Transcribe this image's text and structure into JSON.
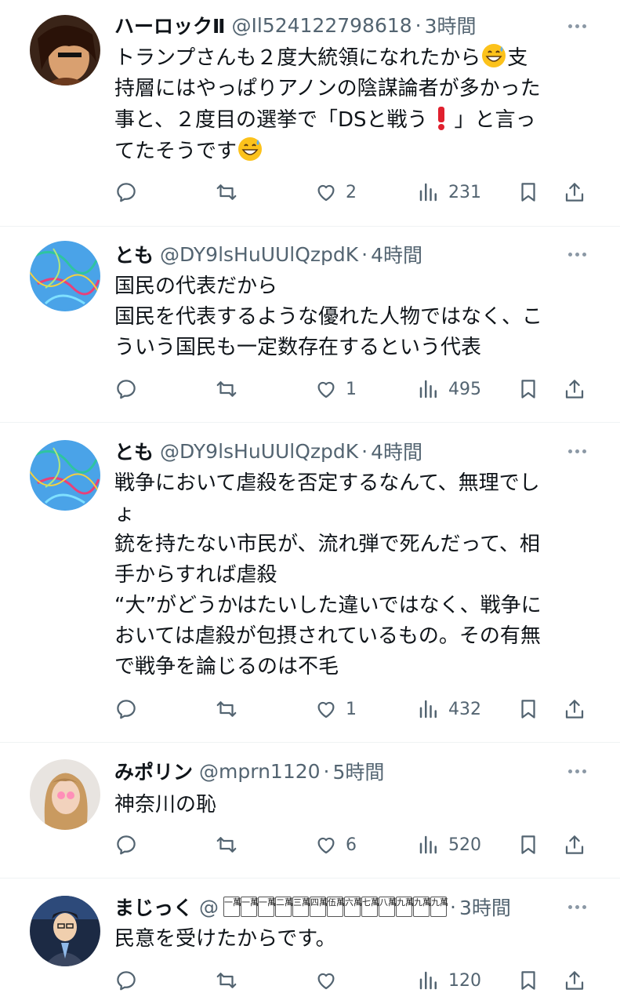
{
  "tweets": [
    {
      "name": "ハーロックⅡ",
      "handle": "@Il524122798618",
      "time": "3時間",
      "lines": [
        "トランプさんも２度大統領になれたから",
        "支",
        "持層にはやっぱりアノンの陰謀論者が多かった",
        "事と、２度目の選挙で「DSと戦う",
        "」と言っ",
        "てたそうです"
      ],
      "replies": "",
      "retweets": "",
      "likes": "2",
      "views": "231"
    },
    {
      "name": "とも",
      "handle": "@DY9lsHuUUlQzpdK",
      "time": "4時間",
      "lines": [
        "国民の代表だから",
        "国民を代表するような優れた人物ではなく、こ",
        "ういう国民も一定数存在するという代表"
      ],
      "likes": "1",
      "views": "495"
    },
    {
      "name": "とも",
      "handle": "@DY9lsHuUUlQzpdK",
      "time": "4時間",
      "lines": [
        "戦争において虐殺を否定するなんて、無理でし",
        "ょ",
        "銃を持たない市民が、流れ弾で死んだって、相",
        "手からすれば虐殺",
        "“大”がどうかはたいした違いではなく、戦争に",
        "おいては虐殺が包摂されているもの。その有無",
        "で戦争を論じるのは不毛"
      ],
      "likes": "1",
      "views": "432"
    },
    {
      "name": "みポリン",
      "handle": "@mprn1120",
      "time": "5時間",
      "lines": [
        "神奈川の恥"
      ],
      "likes": "6",
      "views": "520"
    },
    {
      "name": "まじっく",
      "handle": "@",
      "handle_badges": [
        "一萬",
        "一萬",
        "一萬",
        "二萬",
        "三萬",
        "四萬",
        "伍萬",
        "六萬",
        "七萬",
        "八萬",
        "九萬",
        "九萬",
        "九萬"
      ],
      "time": "3時間",
      "lines": [
        "民意を受けたからです。"
      ],
      "likes": "",
      "views": "120"
    }
  ],
  "colors": {
    "text": "#0f1419",
    "muted": "#536471",
    "divider": "#eff3f4"
  },
  "icons": [
    "reply-icon",
    "retweet-icon",
    "like-icon",
    "views-icon",
    "bookmark-icon",
    "share-icon",
    "more-icon"
  ]
}
